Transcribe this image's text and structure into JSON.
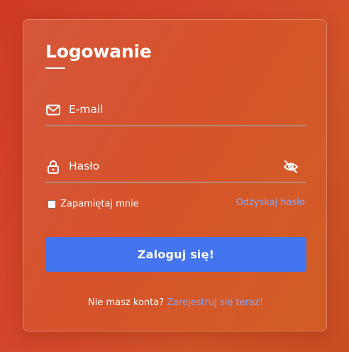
{
  "login_card": {
    "title": "Logowanie",
    "email_field": {
      "placeholder": "E-mail",
      "value": "",
      "icon": "envelope-icon"
    },
    "password_field": {
      "placeholder": "Hasło",
      "value": "",
      "icon": "lock-icon",
      "toggle_icon": "eye-slash-icon"
    },
    "remember_me": {
      "label": "Zapamiętaj mnie",
      "checked": false
    },
    "recover_link": "Odzyskaj hasło",
    "submit_label": "Zaloguj się!",
    "signup_prompt": "Nie masz konta?",
    "signup_link": "Zarejestruj się teraz!"
  },
  "colors": {
    "background": "#d2462a",
    "button": "#4574ef",
    "link": "#8aa8f5",
    "text": "#ffffff"
  }
}
